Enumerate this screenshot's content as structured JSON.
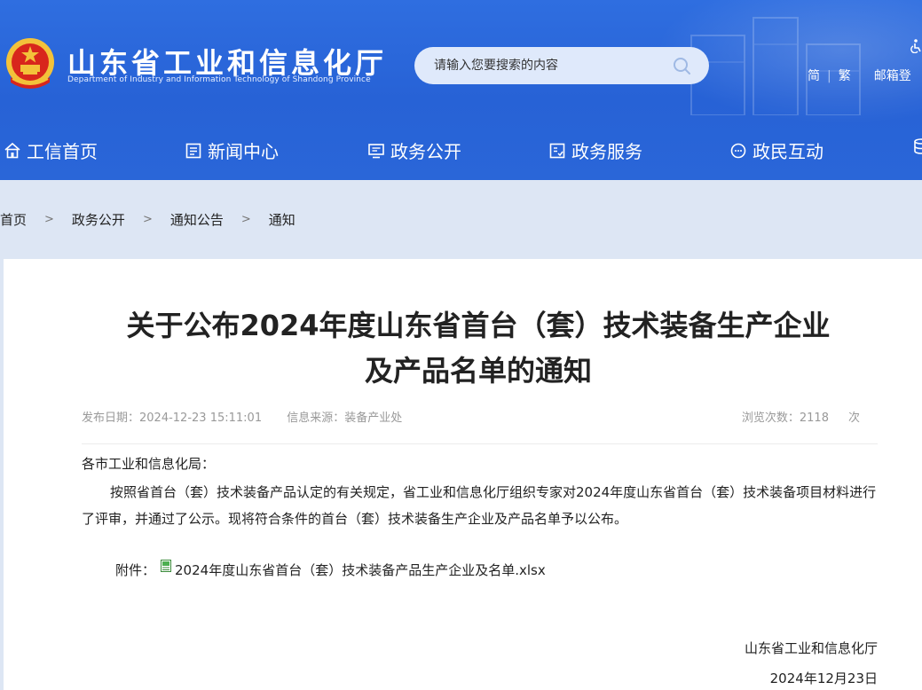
{
  "header": {
    "site_title": "山东省工业和信息化厅",
    "site_subtitle": "Department of Industry and Information Technology of Shandong Province",
    "search_placeholder": "请输入您要搜索的内容",
    "lang_simplified": "简",
    "lang_traditional": "繁",
    "mail": "邮箱登",
    "colors": {
      "header_blue": "#2762d6",
      "breadcrumb_bg": "#dde6f4"
    }
  },
  "nav": {
    "items": [
      {
        "label": "工信首页",
        "icon": "home-icon"
      },
      {
        "label": "新闻中心",
        "icon": "news-icon"
      },
      {
        "label": "政务公开",
        "icon": "monitor-icon"
      },
      {
        "label": "政务服务",
        "icon": "service-icon"
      },
      {
        "label": "政民互动",
        "icon": "chat-icon"
      }
    ]
  },
  "breadcrumb": {
    "items": [
      "首页",
      "政务公开",
      "通知公告",
      "通知"
    ],
    "separator": ">"
  },
  "article": {
    "title_line1": "关于公布2024年度山东省首台（套）技术装备生产企业",
    "title_line2": "及产品名单的通知",
    "publish_label": "发布日期：",
    "publish_date": "2024-12-23 15:11:01",
    "source_label": "信息来源：",
    "source": "装备产业处",
    "views_label": "浏览次数：",
    "views": "2118",
    "views_unit": "次",
    "salutation": "各市工业和信息化局：",
    "paragraph": "按照省首台（套）技术装备产品认定的有关规定，省工业和信息化厅组织专家对2024年度山东省首台（套）技术装备项目材料进行了评审，并通过了公示。现将符合条件的首台（套）技术装备生产企业及产品名单予以公布。",
    "attachment_label": "附件：",
    "attachment_file": "2024年度山东省首台（套）技术装备产品生产企业及名单.xlsx",
    "signature_org": "山东省工业和信息化厅",
    "signature_date": "2024年12月23日"
  }
}
